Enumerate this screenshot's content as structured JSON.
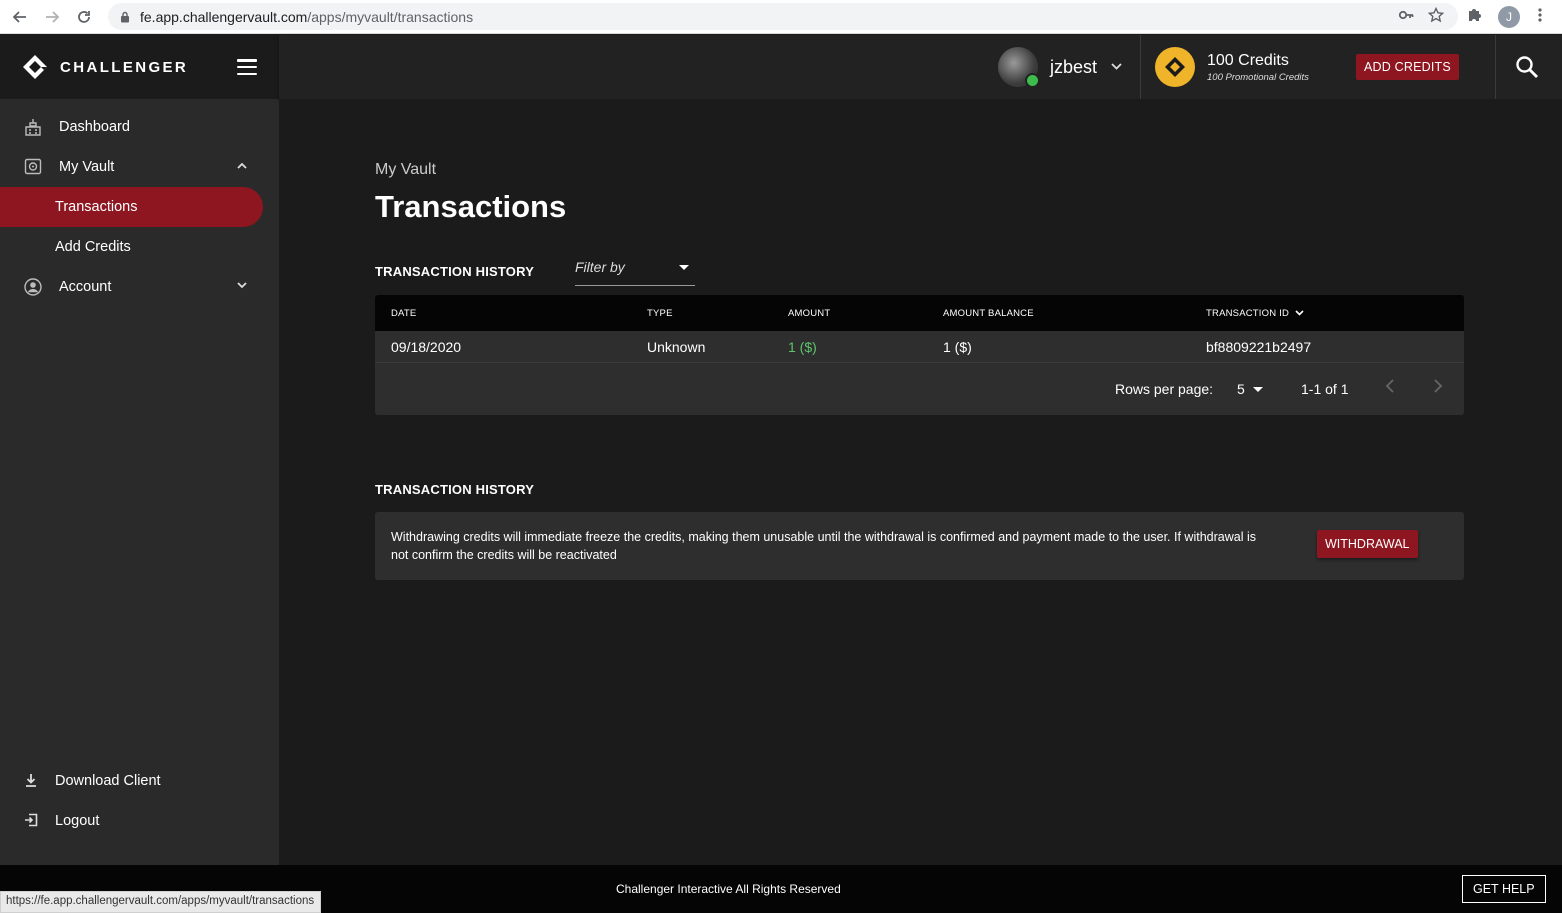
{
  "browser": {
    "url_host": "fe.app.challengervault.com",
    "url_path": "/apps/myvault/transactions",
    "profile_initial": "J",
    "status_url": "https://fe.app.challengervault.com/apps/myvault/transactions"
  },
  "brand": {
    "name": "CHALLENGER"
  },
  "sidebar": {
    "items": [
      {
        "label": "Dashboard",
        "icon": "dashboard-icon"
      },
      {
        "label": "My Vault",
        "icon": "vault-icon"
      },
      {
        "label": "Account",
        "icon": "account-icon"
      }
    ],
    "vault_sub": [
      {
        "label": "Transactions",
        "active": true
      },
      {
        "label": "Add Credits",
        "active": false
      }
    ],
    "bottom": [
      {
        "label": "Download Client",
        "icon": "download-icon"
      },
      {
        "label": "Logout",
        "icon": "logout-icon"
      }
    ]
  },
  "header": {
    "username": "jzbest",
    "credits": "100 Credits",
    "promo_credits": "100 Promotional Credits",
    "add_credits_label": "ADD CREDITS"
  },
  "page": {
    "breadcrumb": "My Vault",
    "title": "Transactions",
    "history_title": "TRANSACTION HISTORY",
    "filter_placeholder": "Filter by",
    "table": {
      "columns": [
        "DATE",
        "TYPE",
        "AMOUNT",
        "AMOUNT BALANCE",
        "TRANSACTION ID"
      ],
      "rows": [
        {
          "date": "09/18/2020",
          "type": "Unknown",
          "amount": "1 ($)",
          "balance": "1 ($)",
          "id": "bf8809221b2497"
        }
      ]
    },
    "pager": {
      "rows_label": "Rows per page:",
      "rows_value": "5",
      "range": "1-1 of 1"
    },
    "withdraw_title": "TRANSACTION HISTORY",
    "withdraw_text": "Withdrawing credits will immediate freeze the credits, making them unusable until the withdrawal is confirmed and payment made to the user. If withdrawal is not confirm the credits will be reactivated",
    "withdraw_label": "WITHDRAWAL"
  },
  "footer": {
    "copyright": "Challenger Interactive All Rights Reserved",
    "help_label": "GET HELP"
  },
  "colors": {
    "accent": "#8e1620",
    "coin": "#f0b42a",
    "positive": "#5cc46a",
    "online": "#3dbb4c"
  }
}
